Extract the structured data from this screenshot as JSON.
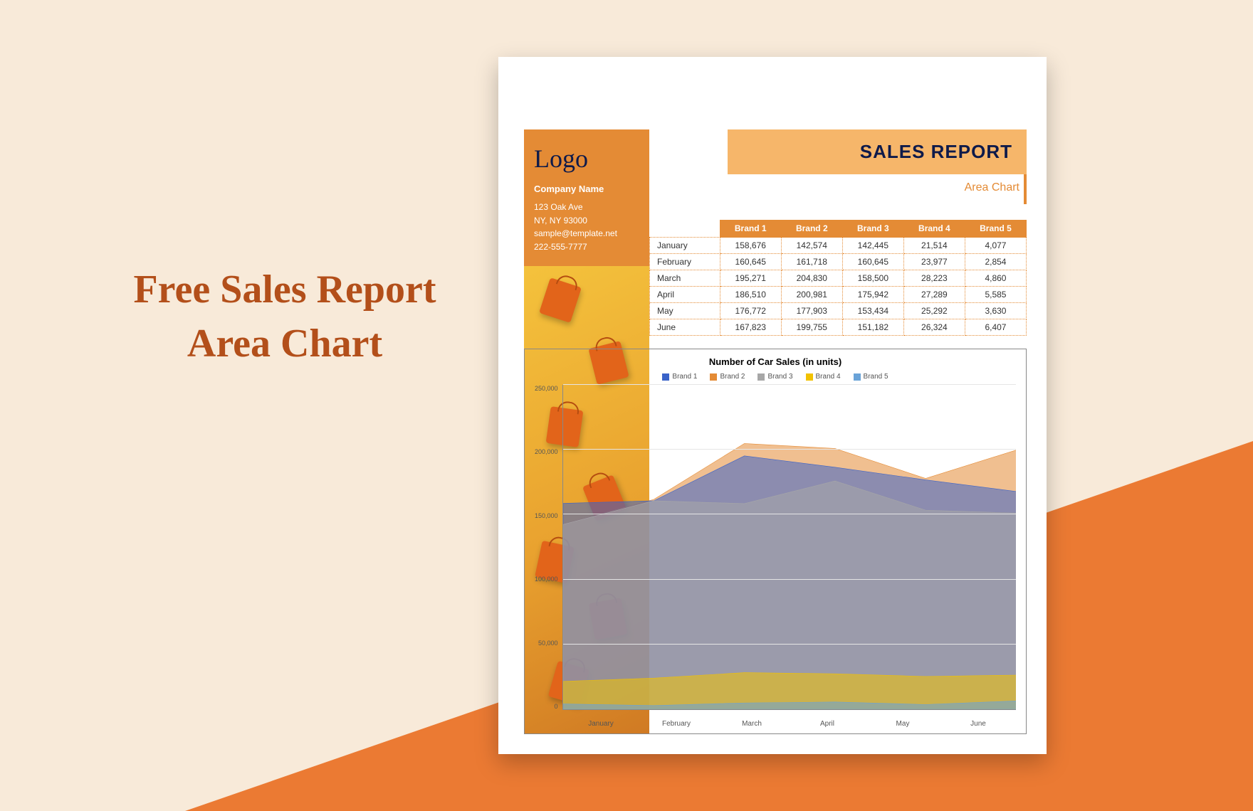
{
  "page_heading_line1": "Free Sales Report",
  "page_heading_line2": "Area Chart",
  "company": {
    "logo": "Logo",
    "name": "Company Name",
    "address1": "123 Oak Ave",
    "address2": "NY, NY 93000",
    "email": "sample@template.net",
    "phone": "222-555-7777"
  },
  "report": {
    "title": "SALES REPORT",
    "subtitle": "Area Chart"
  },
  "table": {
    "headers": [
      "",
      "Brand 1",
      "Brand 2",
      "Brand 3",
      "Brand 4",
      "Brand 5"
    ],
    "rows": [
      {
        "month": "January",
        "v": [
          "158,676",
          "142,574",
          "142,445",
          "21,514",
          "4,077"
        ]
      },
      {
        "month": "February",
        "v": [
          "160,645",
          "161,718",
          "160,645",
          "23,977",
          "2,854"
        ]
      },
      {
        "month": "March",
        "v": [
          "195,271",
          "204,830",
          "158,500",
          "28,223",
          "4,860"
        ]
      },
      {
        "month": "April",
        "v": [
          "186,510",
          "200,981",
          "175,942",
          "27,289",
          "5,585"
        ]
      },
      {
        "month": "May",
        "v": [
          "176,772",
          "177,903",
          "153,434",
          "25,292",
          "3,630"
        ]
      },
      {
        "month": "June",
        "v": [
          "167,823",
          "199,755",
          "151,182",
          "26,324",
          "6,407"
        ]
      }
    ]
  },
  "chart_data": {
    "type": "area",
    "title": "Number of Car Sales (in units)",
    "xlabel": "",
    "ylabel": "",
    "ylim": [
      0,
      250000
    ],
    "yticks": [
      0,
      50000,
      100000,
      150000,
      200000,
      250000
    ],
    "categories": [
      "January",
      "February",
      "March",
      "April",
      "May",
      "June"
    ],
    "series": [
      {
        "name": "Brand 1",
        "color": "#3a63c9",
        "values": [
          158676,
          160645,
          195271,
          186510,
          176772,
          167823
        ]
      },
      {
        "name": "Brand 2",
        "color": "#e48b35",
        "values": [
          142574,
          161718,
          204830,
          200981,
          177903,
          199755
        ]
      },
      {
        "name": "Brand 3",
        "color": "#a7a7a7",
        "values": [
          142445,
          160645,
          158500,
          175942,
          153434,
          151182
        ]
      },
      {
        "name": "Brand 4",
        "color": "#f2c200",
        "values": [
          21514,
          23977,
          28223,
          27289,
          25292,
          26324
        ]
      },
      {
        "name": "Brand 5",
        "color": "#6aa3d8",
        "values": [
          4077,
          2854,
          4860,
          5585,
          3630,
          6407
        ]
      }
    ]
  }
}
